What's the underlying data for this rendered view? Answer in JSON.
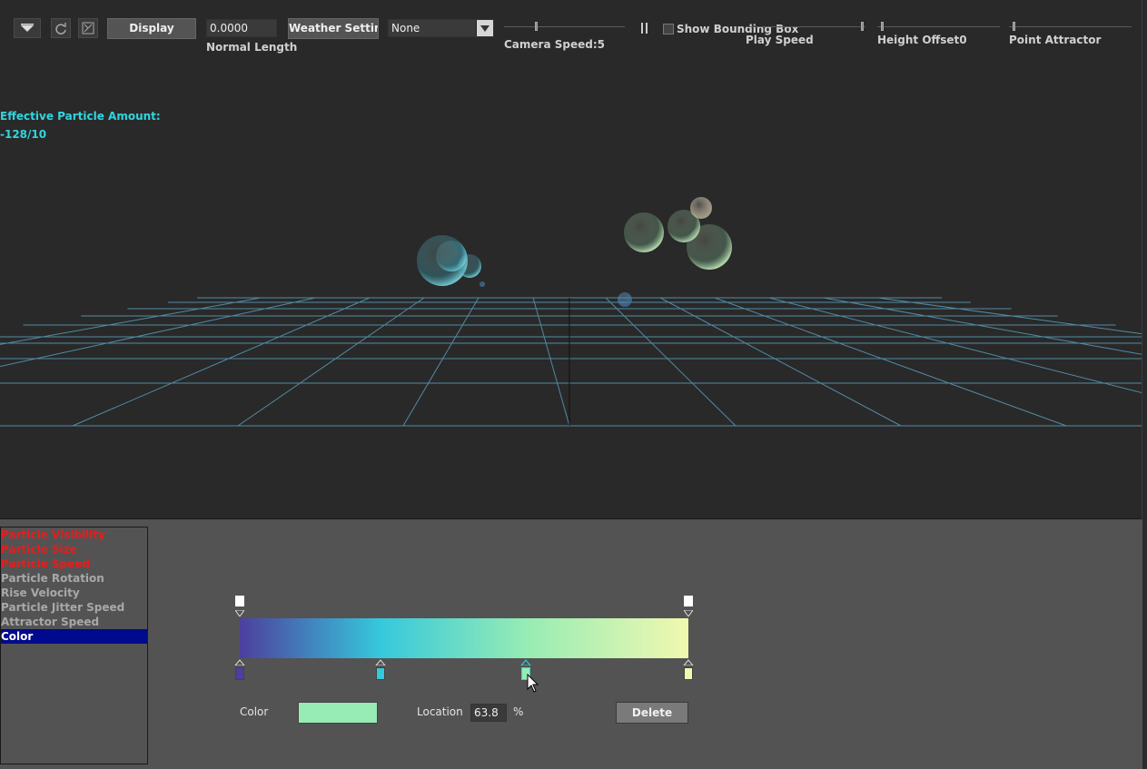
{
  "toolbar": {
    "display_label": "Display",
    "normal_length_value": "0.0000",
    "normal_length_label": "Normal Length",
    "weather_settings_label": "Weather Settings",
    "preset_select_value": "None",
    "camera_speed_label": "Camera Speed:5",
    "pause_icon": "pause-icon",
    "show_bounding_box_label": "Show Bounding Box",
    "play_speed_label": "Play Speed",
    "height_offset_label": "Height Offset0",
    "point_attractor_label": "Point Attractor"
  },
  "viewport": {
    "effective_particle_label": "Effective Particle Amount:",
    "effective_particle_value": "-128/10"
  },
  "property_list": {
    "items": [
      {
        "label": "Particle Visibility",
        "state": "red"
      },
      {
        "label": "Particle Size",
        "state": "red"
      },
      {
        "label": "Particle Speed",
        "state": "red"
      },
      {
        "label": "Particle Rotation",
        "state": "gray"
      },
      {
        "label": "Rise Velocity",
        "state": "gray"
      },
      {
        "label": "Particle Jitter Speed",
        "state": "gray"
      },
      {
        "label": "Attractor Speed",
        "state": "gray"
      },
      {
        "label": "Color",
        "state": "selected"
      }
    ]
  },
  "gradient_editor": {
    "color_label": "Color",
    "location_label": "Location",
    "location_value": "63.8",
    "percent_label": "%",
    "delete_label": "Delete",
    "selected_color": "#96ecb4",
    "stops": [
      {
        "color": "#4d3f9e",
        "location": 0
      },
      {
        "color": "#36c8dc",
        "location": 31.4
      },
      {
        "color": "#96ecb4",
        "location": 63.8
      },
      {
        "color": "#f1f8b0",
        "location": 100
      }
    ]
  },
  "colors": {
    "accent_cyan": "#2fd6e0",
    "disabled_red": "#e81c1c",
    "selection_blue": "#000a8c"
  }
}
